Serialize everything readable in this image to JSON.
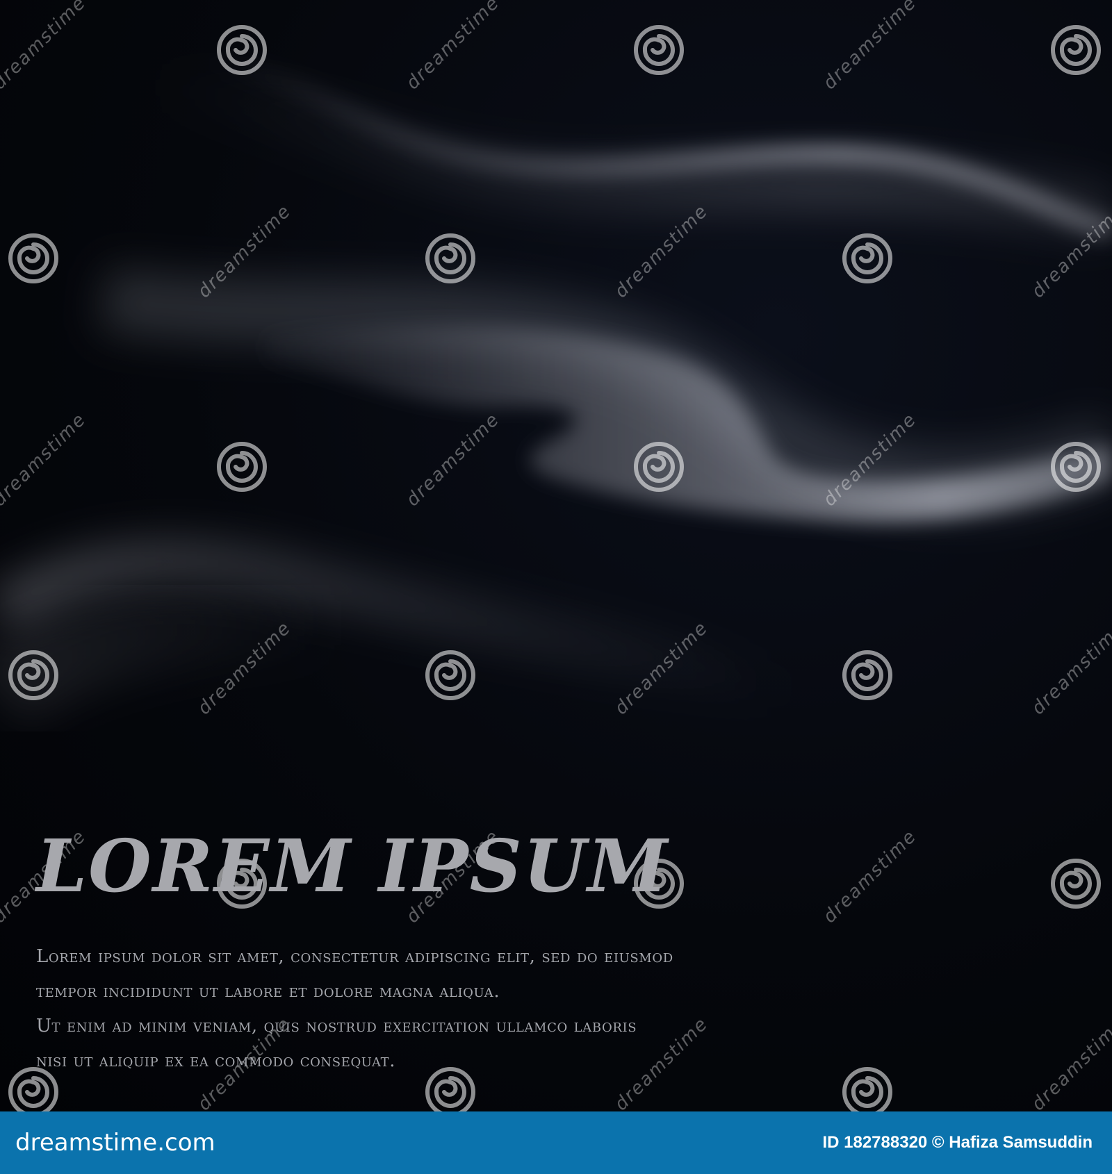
{
  "poster": {
    "headline": "LOREM IPSUM",
    "body_lines": [
      "Lorem ipsum dolor sit amet, consectetur adipiscing elit, sed do eiusmod",
      "tempor incididunt ut labore et dolore magna aliqua.",
      "Ut enim ad minim veniam, quis nostrud exercitation ullamco laboris",
      "nisi ut aliquip ex ea commodo consequat."
    ],
    "background_color": "#05070c",
    "smoke_color": "#c9cbd6",
    "text_color": "#a7a8ad"
  },
  "watermark": {
    "text": "dreamstime",
    "icon": "spiral-icon",
    "color": "#ffffff"
  },
  "footer": {
    "site": "dreamstime.com",
    "credit": "ID 182788320 © Hafiza Samsuddin",
    "background_color": "#0b73ad"
  }
}
